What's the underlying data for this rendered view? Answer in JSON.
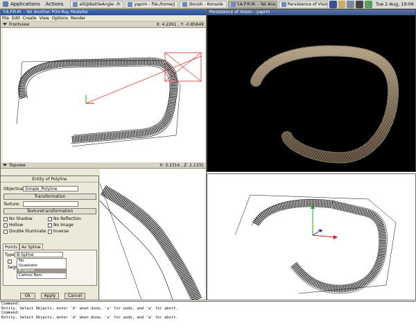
{
  "panel": {
    "menus": [
      "Applications",
      "Actions"
    ],
    "tasks": [
      {
        "label": "alll@BattleAngle: /h",
        "active": false
      },
      {
        "label": "yaprm - file:/home/j",
        "active": false
      },
      {
        "label": "/bin/sh - Konsole",
        "active": false
      },
      {
        "label": "Y.A.P.R.M. - Yet Ano",
        "active": true
      },
      {
        "label": "Persistence of Visio",
        "active": false
      }
    ],
    "tray_icons": [
      "network-icon",
      "notes-icon",
      "mail-icon",
      "volume-icon",
      "monitor-icon"
    ],
    "clock": "Tue  2 Aug, 19:06"
  },
  "modeller": {
    "title": "Y.A.P.R.M. - Yet Another POV-Ray Modeller",
    "menu": [
      "File",
      "Edit",
      "Create",
      "View",
      "Options",
      "Render"
    ],
    "front_view": {
      "label": "Frontview",
      "coords": "X: 4.2261 , Y: -0.85649"
    },
    "top_view": {
      "label": "Topview",
      "coords": "X: 3.2314 , Z: 2.1331"
    }
  },
  "render_window": {
    "title": "Persistence of Vision - yaprm"
  },
  "dialog": {
    "title": "Entity of Polyline",
    "objectname_label": "Objectname:",
    "objectname_value": "Simple_Polyline",
    "transformation_button": "Transformation",
    "texture_label": "Texture:",
    "texture_value": "",
    "texturetransformation_button": "Texturetransformation",
    "checkboxes": {
      "no_shadow": "No Shadow",
      "no_reflection": "No Reflection",
      "hollow": "Hollow",
      "no_image": "No Image",
      "double_illuminate": "Double Illuminate",
      "inverse": "Inverse"
    },
    "tabs": [
      "Points",
      "As Spline"
    ],
    "type_label": "Type",
    "type_value": "B-Spline",
    "segments_label": "Segm",
    "options": [
      "No",
      "Quadratic",
      "B-Spline",
      "Catmul Rom"
    ],
    "selected_option": "B-Spline",
    "ok_button": "Ok",
    "apply_button": "Apply",
    "cancel_button": "Cancel"
  },
  "console": {
    "lines": [
      "Command:",
      "Entity.  Select Objects, enter 'd' when done, 'u' for undo, and 'a' for abort.",
      "Command:",
      "Entity.  Select Objects, enter 'd' when done, 'u' for undo, and 'a' for abort."
    ]
  },
  "colors": {
    "panel": "#dcdad5",
    "titlebar": "#274f93",
    "wire": "#000000",
    "selection": "#e02020",
    "axis_x": "#d01818",
    "axis_y": "#10b010",
    "axis_z": "#1818d0",
    "render_bg": "#000000",
    "tube": "#9c8a70"
  }
}
